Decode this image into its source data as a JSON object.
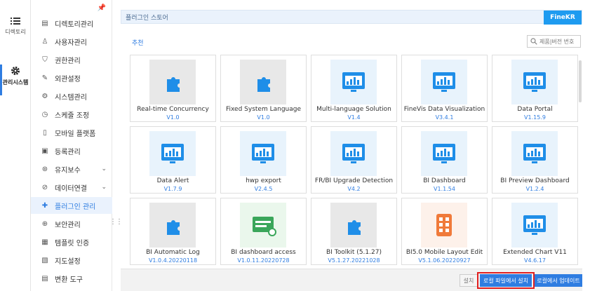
{
  "rail": {
    "directory_label": "디렉토리",
    "system_label": "관리시스템"
  },
  "menu": {
    "items": [
      {
        "label": "디렉토리관리",
        "icon": "directory-icon"
      },
      {
        "label": "사용자관리",
        "icon": "user-icon"
      },
      {
        "label": "권한관리",
        "icon": "shield-icon"
      },
      {
        "label": "외관설정",
        "icon": "appearance-icon"
      },
      {
        "label": "시스템관리",
        "icon": "gear-icon"
      },
      {
        "label": "스케줄 조정",
        "icon": "clock-icon"
      },
      {
        "label": "모바일 플랫폼",
        "icon": "mobile-icon"
      },
      {
        "label": "등록관리",
        "icon": "register-icon"
      },
      {
        "label": "유지보수",
        "icon": "maintenance-icon"
      },
      {
        "label": "데이터연결",
        "icon": "data-connection-icon"
      },
      {
        "label": "플러그인 관리",
        "icon": "plugin-icon"
      },
      {
        "label": "보안관리",
        "icon": "security-icon"
      },
      {
        "label": "템플릿 인증",
        "icon": "template-icon"
      },
      {
        "label": "지도설정",
        "icon": "map-icon"
      },
      {
        "label": "변환 도구",
        "icon": "convert-icon"
      }
    ]
  },
  "main": {
    "title": "플러그인 스토어",
    "brand_button": "FineKR",
    "section_label": "추천",
    "search_placeholder": "제품|버전 번호"
  },
  "plugins": [
    {
      "name": "Real-time Concurrency",
      "version": "V1.0"
    },
    {
      "name": "Fixed System Language",
      "version": "V1.0"
    },
    {
      "name": "Multi-language Solution",
      "version": "V1.4"
    },
    {
      "name": "FineVis Data Visualization",
      "version": "V3.4.1"
    },
    {
      "name": "Data Portal",
      "version": "V1.15.9"
    },
    {
      "name": "Data Alert",
      "version": "V1.7.9"
    },
    {
      "name": "hwp export",
      "version": "V2.4.5"
    },
    {
      "name": "FR/BI Upgrade Detection",
      "version": "V4.2"
    },
    {
      "name": "BI Dashboard",
      "version": "V1.1.54"
    },
    {
      "name": "BI Preview Dashboard",
      "version": "V1.2.4"
    },
    {
      "name": "BI Automatic Log",
      "version": "V1.0.4.20220118"
    },
    {
      "name": "BI dashboard access",
      "version": "V1.0.11.20220728"
    },
    {
      "name": "BI Toolkit (5.1.27)",
      "version": "V5.1.27.20221028"
    },
    {
      "name": "BI5.0 Mobile Layout Edit",
      "version": "V5.1.06.20220927"
    },
    {
      "name": "Extended Chart V11",
      "version": "V4.6.17"
    }
  ],
  "footer": {
    "install_label": "설치",
    "install_local_label": "로컬 파일에서 설치",
    "update_local_label": "로컬에서 업데이트"
  },
  "colors": {
    "accent": "#2f7de1",
    "brand": "#1e9bf0",
    "highlight_outline": "#e02020"
  }
}
